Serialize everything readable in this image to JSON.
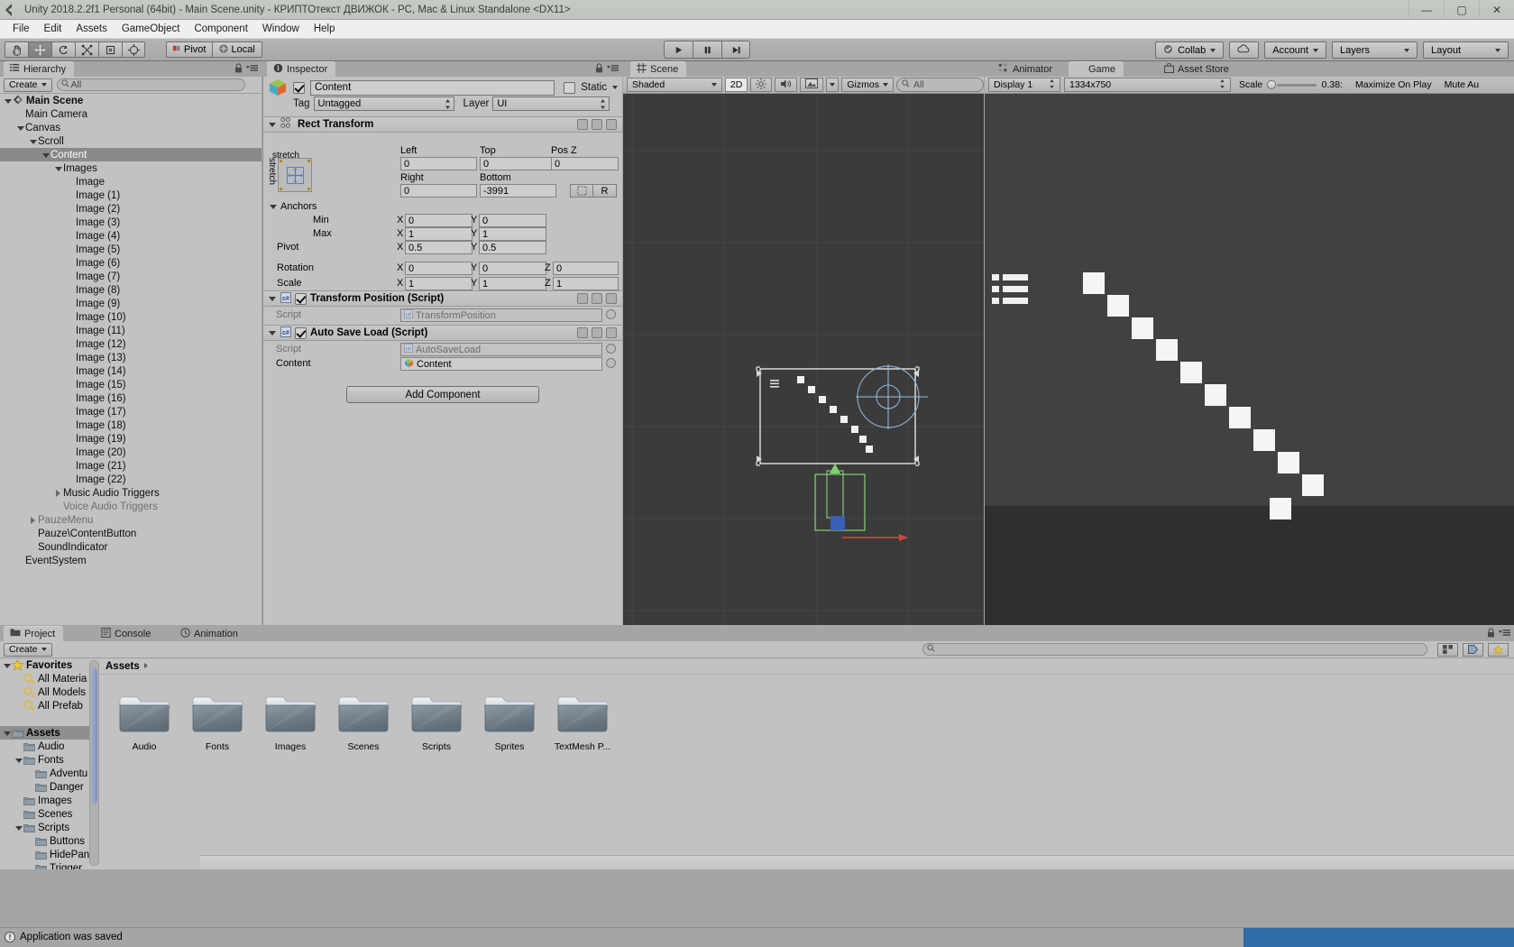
{
  "window": {
    "title": "Unity 2018.2.2f1 Personal (64bit) - Main Scene.unity - КРИПТОтекст ДВИЖОК - PC, Mac & Linux Standalone <DX11>",
    "minimize": "—",
    "maximize": "▢",
    "close": "✕",
    "logo_icon": "unity-logo-icon"
  },
  "menu": {
    "items": [
      "File",
      "Edit",
      "Assets",
      "GameObject",
      "Component",
      "Window",
      "Help"
    ]
  },
  "toolbar": {
    "tools": [
      {
        "name": "hand-tool",
        "glyph": "✋"
      },
      {
        "name": "move-tool",
        "glyph": "✥"
      },
      {
        "name": "rotate-tool",
        "glyph": "⟳"
      },
      {
        "name": "scale-tool",
        "glyph": "⤢"
      },
      {
        "name": "rect-tool",
        "glyph": "▣"
      },
      {
        "name": "transform-tool",
        "glyph": "✸"
      }
    ],
    "pivot_label": "Pivot",
    "local_label": "Local",
    "play_label": "▶",
    "pause_label": "❚❚",
    "step_label": "▶❚",
    "collab_label": "Collab",
    "cloud_label": "cloud-icon",
    "account_label": "Account",
    "layers_label": "Layers",
    "layout_label": "Layout"
  },
  "hierarchy": {
    "tab": "Hierarchy",
    "create_label": "Create",
    "search_placeholder": "All",
    "items": [
      {
        "label": "Main Scene",
        "depth": 0,
        "tri": "down",
        "bold": true,
        "selected": false,
        "dim": false,
        "icon": "scene-icon"
      },
      {
        "label": "Main Camera",
        "depth": 1,
        "tri": "none",
        "bold": false,
        "selected": false,
        "dim": false
      },
      {
        "label": "Canvas",
        "depth": 1,
        "tri": "down",
        "bold": false,
        "selected": false,
        "dim": false
      },
      {
        "label": "Scroll",
        "depth": 2,
        "tri": "down",
        "bold": false,
        "selected": false,
        "dim": false
      },
      {
        "label": "Content",
        "depth": 3,
        "tri": "down",
        "bold": false,
        "selected": true,
        "dim": false
      },
      {
        "label": "Images",
        "depth": 4,
        "tri": "down",
        "bold": false,
        "selected": false,
        "dim": false
      },
      {
        "label": "Image",
        "depth": 5,
        "tri": "none",
        "bold": false,
        "selected": false,
        "dim": false
      },
      {
        "label": "Image (1)",
        "depth": 5,
        "tri": "none",
        "bold": false,
        "selected": false,
        "dim": false
      },
      {
        "label": "Image (2)",
        "depth": 5,
        "tri": "none",
        "bold": false,
        "selected": false,
        "dim": false
      },
      {
        "label": "Image (3)",
        "depth": 5,
        "tri": "none",
        "bold": false,
        "selected": false,
        "dim": false
      },
      {
        "label": "Image (4)",
        "depth": 5,
        "tri": "none",
        "bold": false,
        "selected": false,
        "dim": false
      },
      {
        "label": "Image (5)",
        "depth": 5,
        "tri": "none",
        "bold": false,
        "selected": false,
        "dim": false
      },
      {
        "label": "Image (6)",
        "depth": 5,
        "tri": "none",
        "bold": false,
        "selected": false,
        "dim": false
      },
      {
        "label": "Image (7)",
        "depth": 5,
        "tri": "none",
        "bold": false,
        "selected": false,
        "dim": false
      },
      {
        "label": "Image (8)",
        "depth": 5,
        "tri": "none",
        "bold": false,
        "selected": false,
        "dim": false
      },
      {
        "label": "Image (9)",
        "depth": 5,
        "tri": "none",
        "bold": false,
        "selected": false,
        "dim": false
      },
      {
        "label": "Image (10)",
        "depth": 5,
        "tri": "none",
        "bold": false,
        "selected": false,
        "dim": false
      },
      {
        "label": "Image (11)",
        "depth": 5,
        "tri": "none",
        "bold": false,
        "selected": false,
        "dim": false
      },
      {
        "label": "Image (12)",
        "depth": 5,
        "tri": "none",
        "bold": false,
        "selected": false,
        "dim": false
      },
      {
        "label": "Image (13)",
        "depth": 5,
        "tri": "none",
        "bold": false,
        "selected": false,
        "dim": false
      },
      {
        "label": "Image (14)",
        "depth": 5,
        "tri": "none",
        "bold": false,
        "selected": false,
        "dim": false
      },
      {
        "label": "Image (15)",
        "depth": 5,
        "tri": "none",
        "bold": false,
        "selected": false,
        "dim": false
      },
      {
        "label": "Image (16)",
        "depth": 5,
        "tri": "none",
        "bold": false,
        "selected": false,
        "dim": false
      },
      {
        "label": "Image (17)",
        "depth": 5,
        "tri": "none",
        "bold": false,
        "selected": false,
        "dim": false
      },
      {
        "label": "Image (18)",
        "depth": 5,
        "tri": "none",
        "bold": false,
        "selected": false,
        "dim": false
      },
      {
        "label": "Image (19)",
        "depth": 5,
        "tri": "none",
        "bold": false,
        "selected": false,
        "dim": false
      },
      {
        "label": "Image (20)",
        "depth": 5,
        "tri": "none",
        "bold": false,
        "selected": false,
        "dim": false
      },
      {
        "label": "Image (21)",
        "depth": 5,
        "tri": "none",
        "bold": false,
        "selected": false,
        "dim": false
      },
      {
        "label": "Image (22)",
        "depth": 5,
        "tri": "none",
        "bold": false,
        "selected": false,
        "dim": false
      },
      {
        "label": "Music Audio Triggers",
        "depth": 4,
        "tri": "right",
        "bold": false,
        "selected": false,
        "dim": false
      },
      {
        "label": "Voice Audio Triggers",
        "depth": 4,
        "tri": "none",
        "bold": false,
        "selected": false,
        "dim": true
      },
      {
        "label": "PauzeMenu",
        "depth": 2,
        "tri": "right",
        "bold": false,
        "selected": false,
        "dim": true
      },
      {
        "label": "Pauze\\ContentButton",
        "depth": 2,
        "tri": "none",
        "bold": false,
        "selected": false,
        "dim": false
      },
      {
        "label": "SoundIndicator",
        "depth": 2,
        "tri": "none",
        "bold": false,
        "selected": false,
        "dim": false
      },
      {
        "label": "EventSystem",
        "depth": 1,
        "tri": "none",
        "bold": false,
        "selected": false,
        "dim": false
      }
    ]
  },
  "inspector": {
    "tab": "Inspector",
    "object_enabled": true,
    "object_name": "Content",
    "static_label": "Static",
    "static_checked": false,
    "tag_label": "Tag",
    "tag_value": "Untagged",
    "layer_label": "Layer",
    "layer_value": "UI",
    "rect_transform": {
      "title": "Rect Transform",
      "anchor_preset_h": "stretch",
      "anchor_preset_v": "stretch",
      "left_label": "Left",
      "left_value": "0",
      "top_label": "Top",
      "top_value": "0",
      "posz_label": "Pos Z",
      "posz_value": "0",
      "right_label": "Right",
      "right_value": "0",
      "bottom_label": "Bottom",
      "bottom_value": "-3991",
      "blueprint_label": "R",
      "anchors_label": "Anchors",
      "min_label": "Min",
      "min_x": "0",
      "min_y": "0",
      "max_label": "Max",
      "max_x": "1",
      "max_y": "1",
      "pivot_label": "Pivot",
      "pivot_x": "0.5",
      "pivot_y": "0.5",
      "rotation_label": "Rotation",
      "rot_x": "0",
      "rot_y": "0",
      "rot_z": "0",
      "scale_label": "Scale",
      "scale_x": "1",
      "scale_y": "1",
      "scale_z": "1",
      "axis_x": "X",
      "axis_y": "Y",
      "axis_z": "Z"
    },
    "components": [
      {
        "title": "Transform Position (Script)",
        "enabled": true,
        "script_label": "Script",
        "script_value": "TransformPosition",
        "fields": []
      },
      {
        "title": "Auto Save Load (Script)",
        "enabled": true,
        "script_label": "Script",
        "script_value": "AutoSaveLoad",
        "fields": [
          {
            "label": "Content",
            "value": "Content"
          }
        ]
      }
    ],
    "add_component_label": "Add Component"
  },
  "scene": {
    "tab": "Scene",
    "shading_mode": "Shaded",
    "mode_2d": "2D",
    "lighting_icon": "sun-icon",
    "audio_icon": "speaker-icon",
    "effects_icon": "image-icon",
    "gizmos_label": "Gizmos",
    "search_placeholder": "All"
  },
  "game": {
    "tabs": [
      {
        "label": "Animator",
        "active": false,
        "icon": "animator-icon"
      },
      {
        "label": "Game",
        "active": true,
        "icon": "game-icon"
      },
      {
        "label": "Asset Store",
        "active": false,
        "icon": "store-icon"
      }
    ],
    "display_value": "Display 1",
    "aspect_value": "1334x750",
    "scale_label": "Scale",
    "scale_value": "0.38:",
    "maximize_label": "Maximize On Play",
    "mute_label": "Mute Au"
  },
  "project": {
    "tabs": [
      {
        "label": "Project",
        "active": true,
        "icon": "folder-icon"
      },
      {
        "label": "Console",
        "active": false,
        "icon": "console-icon"
      },
      {
        "label": "Animation",
        "active": false,
        "icon": "clock-icon"
      }
    ],
    "create_label": "Create",
    "search_placeholder": "",
    "breadcrumb": "Assets",
    "tree": [
      {
        "label": "Favorites",
        "depth": 0,
        "tri": "down",
        "icon": "star-icon",
        "bold": true,
        "selected": false
      },
      {
        "label": "All Materia",
        "depth": 1,
        "tri": "none",
        "icon": "search-icon",
        "bold": false,
        "selected": false
      },
      {
        "label": "All Models",
        "depth": 1,
        "tri": "none",
        "icon": "search-icon",
        "bold": false,
        "selected": false
      },
      {
        "label": "All Prefab",
        "depth": 1,
        "tri": "none",
        "icon": "search-icon",
        "bold": false,
        "selected": false
      },
      {
        "label": "",
        "depth": 0,
        "tri": "none",
        "icon": "none",
        "bold": false,
        "selected": false
      },
      {
        "label": "Assets",
        "depth": 0,
        "tri": "down",
        "icon": "folder-icon",
        "bold": true,
        "selected": true
      },
      {
        "label": "Audio",
        "depth": 1,
        "tri": "none",
        "icon": "folder-icon",
        "bold": false,
        "selected": false
      },
      {
        "label": "Fonts",
        "depth": 1,
        "tri": "down",
        "icon": "folder-icon",
        "bold": false,
        "selected": false
      },
      {
        "label": "Adventu",
        "depth": 2,
        "tri": "none",
        "icon": "folder-icon",
        "bold": false,
        "selected": false
      },
      {
        "label": "Danger",
        "depth": 2,
        "tri": "none",
        "icon": "folder-icon",
        "bold": false,
        "selected": false
      },
      {
        "label": "Images",
        "depth": 1,
        "tri": "none",
        "icon": "folder-icon",
        "bold": false,
        "selected": false
      },
      {
        "label": "Scenes",
        "depth": 1,
        "tri": "none",
        "icon": "folder-icon",
        "bold": false,
        "selected": false
      },
      {
        "label": "Scripts",
        "depth": 1,
        "tri": "down",
        "icon": "folder-icon",
        "bold": false,
        "selected": false
      },
      {
        "label": "Buttons",
        "depth": 2,
        "tri": "none",
        "icon": "folder-icon",
        "bold": false,
        "selected": false
      },
      {
        "label": "HidePan",
        "depth": 2,
        "tri": "none",
        "icon": "folder-icon",
        "bold": false,
        "selected": false
      },
      {
        "label": "Trigger",
        "depth": 2,
        "tri": "none",
        "icon": "folder-icon",
        "bold": false,
        "selected": false
      }
    ],
    "assets": [
      {
        "label": "Audio",
        "type": "folder"
      },
      {
        "label": "Fonts",
        "type": "folder"
      },
      {
        "label": "Images",
        "type": "folder"
      },
      {
        "label": "Scenes",
        "type": "folder"
      },
      {
        "label": "Scripts",
        "type": "folder"
      },
      {
        "label": "Sprites",
        "type": "folder"
      },
      {
        "label": "TextMesh P...",
        "type": "folder"
      }
    ]
  },
  "status": {
    "message": "Application was saved",
    "icon": "info-icon"
  }
}
